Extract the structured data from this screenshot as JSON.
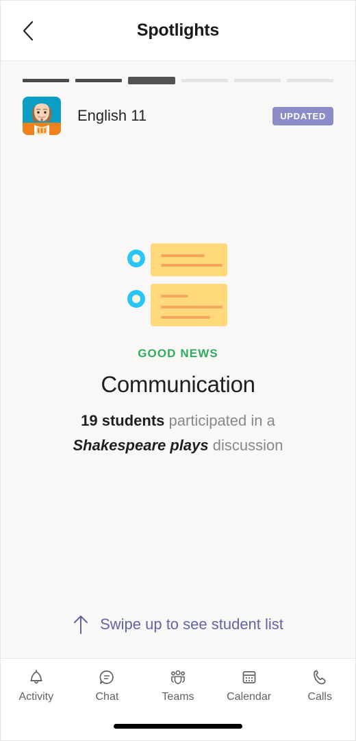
{
  "header": {
    "title": "Spotlights",
    "back_icon": "chevron-left-icon"
  },
  "progress": {
    "total": 6,
    "current_index": 2,
    "segments": [
      "done",
      "done",
      "active",
      "todo",
      "todo",
      "todo"
    ]
  },
  "course": {
    "name": "English 11",
    "avatar_icon": "shakespeare-avatar",
    "badge_label": "UPDATED",
    "badge_color": "#8b8cc8"
  },
  "illustration": {
    "name": "discussion-messages-illustration",
    "card_color": "#ffd97a",
    "line_color": "#f9a45c",
    "ring_color": "#29c5f6",
    "ring_center_color": "#fdf6e3",
    "cards": [
      {
        "lines": [
          118,
          166
        ]
      },
      {
        "lines": [
          74,
          166,
          133
        ]
      }
    ]
  },
  "spotlight": {
    "kicker": "GOOD NEWS",
    "kicker_color": "#2eab5b",
    "headline": "Communication",
    "description_parts": [
      {
        "text": "19 students",
        "style": "strong"
      },
      {
        "text": " participated in a ",
        "style": "normal"
      },
      {
        "text": "Shakespeare plays",
        "style": "em"
      },
      {
        "text": " discussion",
        "style": "normal"
      }
    ],
    "student_count": 19,
    "topic": "Shakespeare plays"
  },
  "swipe": {
    "label": "Swipe up to see student list",
    "arrow_icon": "arrow-up-icon",
    "color": "#6264a7"
  },
  "bottom_nav": {
    "items": [
      {
        "label": "Activity",
        "icon": "bell-icon"
      },
      {
        "label": "Chat",
        "icon": "chat-bubble-icon"
      },
      {
        "label": "Teams",
        "icon": "teams-people-icon"
      },
      {
        "label": "Calendar",
        "icon": "calendar-icon"
      },
      {
        "label": "Calls",
        "icon": "phone-icon"
      }
    ]
  }
}
